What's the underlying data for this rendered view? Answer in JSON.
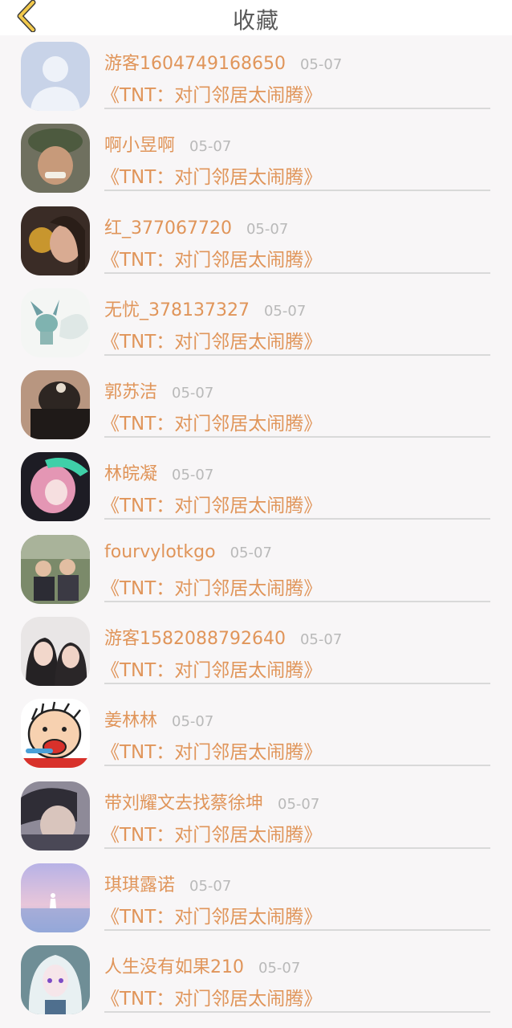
{
  "header": {
    "title": "收藏",
    "back_icon": "chevron-left-icon",
    "accent": "#f2c94c"
  },
  "colors": {
    "name": "#e0955a",
    "date": "#b9b9b9",
    "divider": "#d9d9d9"
  },
  "items": [
    {
      "name": "游客1604749168650",
      "date": "05-07",
      "work": "《TNT：对门邻居太闹腾》"
    },
    {
      "name": "啊小昱啊",
      "date": "05-07",
      "work": "《TNT：对门邻居太闹腾》"
    },
    {
      "name": "红_377067720",
      "date": "05-07",
      "work": "《TNT：对门邻居太闹腾》"
    },
    {
      "name": "无忧_378137327",
      "date": "05-07",
      "work": "《TNT：对门邻居太闹腾》"
    },
    {
      "name": "郭苏洁",
      "date": "05-07",
      "work": "《TNT：对门邻居太闹腾》"
    },
    {
      "name": "林皖凝",
      "date": "05-07",
      "work": "《TNT：对门邻居太闹腾》"
    },
    {
      "name": "fourvylotkgo",
      "date": "05-07",
      "work": "《TNT：对门邻居太闹腾》"
    },
    {
      "name": "游客1582088792640",
      "date": "05-07",
      "work": "《TNT：对门邻居太闹腾》"
    },
    {
      "name": "姜林林",
      "date": "05-07",
      "work": "《TNT：对门邻居太闹腾》"
    },
    {
      "name": "带刘耀文去找蔡徐坤",
      "date": "05-07",
      "work": "《TNT：对门邻居太闹腾》"
    },
    {
      "name": "琪琪露诺",
      "date": "05-07",
      "work": "《TNT：对门邻居太闹腾》"
    },
    {
      "name": "人生没有如果210",
      "date": "05-07",
      "work": "《TNT：对门邻居太闹腾》"
    }
  ]
}
